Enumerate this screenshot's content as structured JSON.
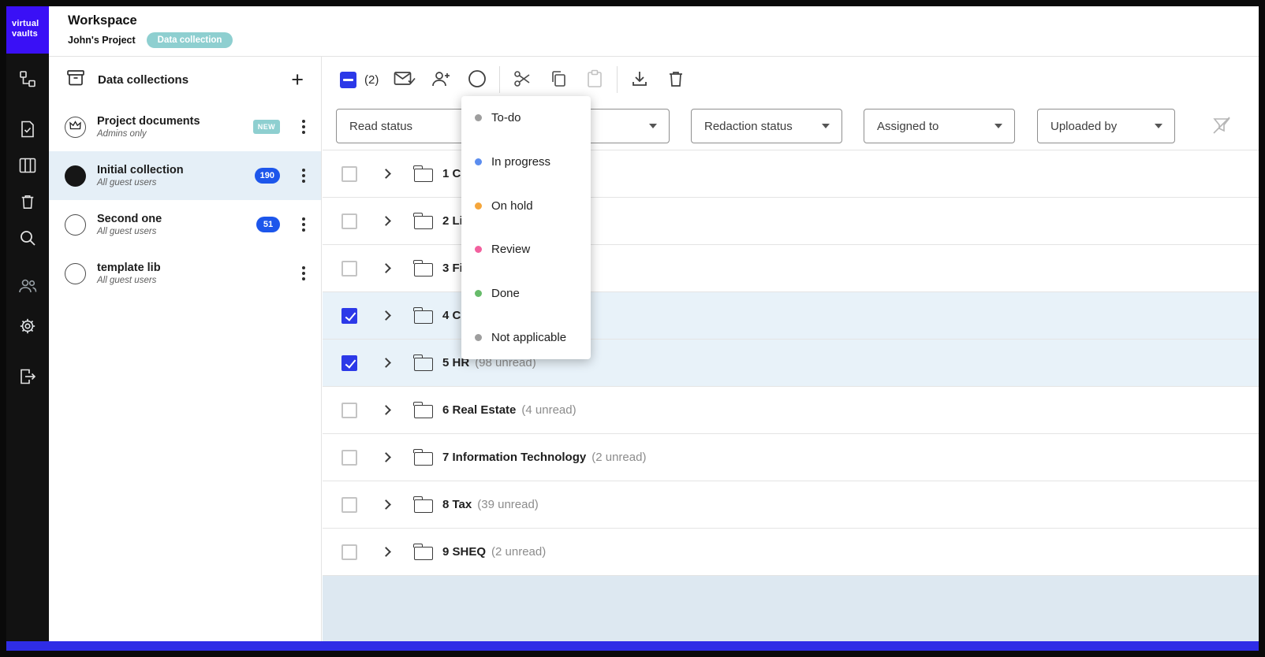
{
  "logo": {
    "line1": "virtual",
    "line2": "vaults"
  },
  "header": {
    "title": "Workspace",
    "project_name": "John's Project",
    "project_badge": "Data collection"
  },
  "collections": {
    "title": "Data collections",
    "add_button": "+",
    "items": [
      {
        "title": "Project documents",
        "subtitle": "Admins only",
        "badge": "NEW"
      },
      {
        "title": "Initial collection",
        "subtitle": "All guest users",
        "count": "190"
      },
      {
        "title": "Second one",
        "subtitle": "All guest users",
        "count": "51"
      },
      {
        "title": "template lib",
        "subtitle": "All guest users"
      }
    ]
  },
  "toolbar": {
    "selection_count": "(2)"
  },
  "filters": [
    {
      "label": "Read status"
    },
    {
      "label": "Redaction status"
    },
    {
      "label": "Assigned to"
    },
    {
      "label": "Uploaded by"
    }
  ],
  "status_menu": {
    "items": [
      {
        "label": "To-do",
        "color": "#9e9e9e"
      },
      {
        "label": "In progress",
        "color": "#5b8def"
      },
      {
        "label": "On hold",
        "color": "#f5a63b"
      },
      {
        "label": "Review",
        "color": "#f2609e"
      },
      {
        "label": "Done",
        "color": "#67bb6a"
      },
      {
        "label": "Not applicable",
        "color": "#9e9e9e"
      }
    ]
  },
  "folders": {
    "rows": [
      {
        "label": "1 Co",
        "unread": "",
        "checked": false
      },
      {
        "label": "2 Li",
        "unread": "",
        "checked": false
      },
      {
        "label": "3 Fi",
        "unread": "",
        "checked": false
      },
      {
        "label": "4 Co",
        "unread": "",
        "checked": true
      },
      {
        "label": "5 HR",
        "unread": "(98 unread)",
        "checked": true
      },
      {
        "label": "6 Real Estate",
        "unread": "(4 unread)",
        "checked": false
      },
      {
        "label": "7 Information Technology",
        "unread": "(2 unread)",
        "checked": false
      },
      {
        "label": "8 Tax",
        "unread": "(39 unread)",
        "checked": false
      },
      {
        "label": "9 SHEQ",
        "unread": "(2 unread)",
        "checked": false
      }
    ]
  },
  "colors": {
    "accent_checkbox_blue": "#2c39e8",
    "count_badge_blue": "#1d56eb",
    "teal_badge": "#8ecfd0",
    "logo_blue": "#3a10f6",
    "selected_row_bg": "#e8f2f9",
    "footer_band": "#dde8f1"
  }
}
